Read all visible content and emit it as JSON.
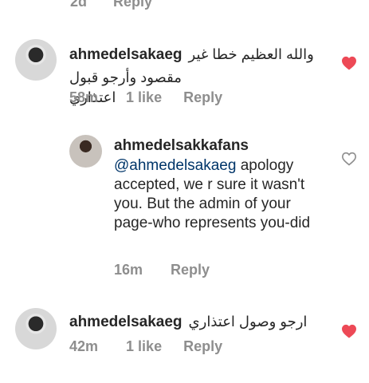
{
  "top_partial": {
    "time": "2d",
    "reply": "Reply"
  },
  "comments": [
    {
      "username": "ahmedelsakaeg",
      "text_line1": "والله العظيم خطا غير",
      "text_line2": "مقصود وأرجو قبول اعتذاري",
      "time": "58m",
      "likes": "1 like",
      "reply": "Reply",
      "liked": true
    },
    {
      "username": "ahmedelsakkafans",
      "mention": "@ahmedelsakaeg",
      "text": " apology accepted, we r sure it wasn't you. But the admin of your page-who represents you-did",
      "time": "16m",
      "reply": "Reply",
      "liked": false
    },
    {
      "username": "ahmedelsakaeg",
      "text": "ارجو وصول اعتذاري",
      "time": "42m",
      "likes": "1 like",
      "reply": "Reply",
      "liked": true
    }
  ],
  "colors": {
    "heart": "#ed4956",
    "meta": "#8e8e8e",
    "mention": "#003569"
  }
}
